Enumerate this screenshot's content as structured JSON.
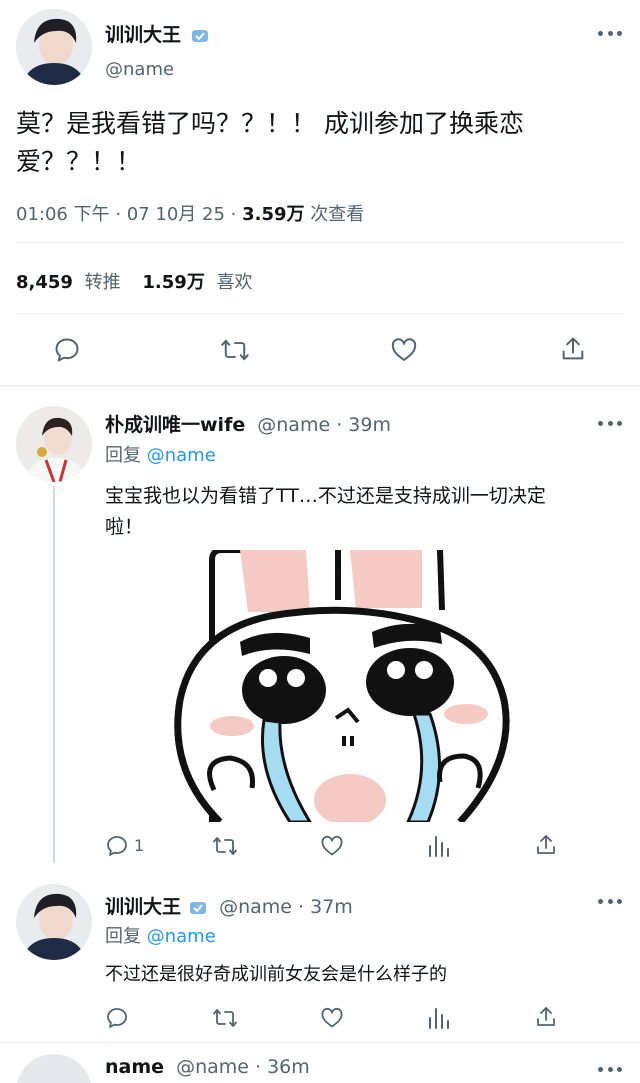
{
  "main_tweet": {
    "name": "训训大王",
    "handle": "@name",
    "text_line1": "莫？是我看错了吗？？！！ 成训参加了换乘恋",
    "text_line2": "爱？？！！",
    "time": "01:06 下午 · 07 10月 25 · ",
    "views_count": "3.59万",
    "views_label": " 次查看",
    "retweets_count": "8,459",
    "retweets_label": "转推",
    "likes_count": "1.59万",
    "likes_label": "喜欢"
  },
  "replies": [
    {
      "name": "朴成训唯一wife",
      "meta": "@name · 39m",
      "reply_prefix": "回复 ",
      "reply_to": "@name",
      "text_line1": "宝宝我也以为看错了TT…不过还是支持成训一切决定",
      "text_line2": "啦！",
      "reply_count": "1"
    },
    {
      "name": "训训大王",
      "meta": "@name · 37m",
      "reply_prefix": "回复 ",
      "reply_to": "@name",
      "text_line1": "不过还是很好奇成训前女友会是什么样子的"
    },
    {
      "name": "name",
      "meta": "@name · 36m"
    }
  ],
  "icons": [
    "more-icon",
    "verified-icon",
    "reply-icon",
    "retweet-icon",
    "like-icon",
    "share-icon",
    "views-icon"
  ],
  "colors": {
    "text": "#0f1419",
    "secondary": "#536471",
    "link": "#1d9bf0",
    "divider": "#eff3f4"
  }
}
